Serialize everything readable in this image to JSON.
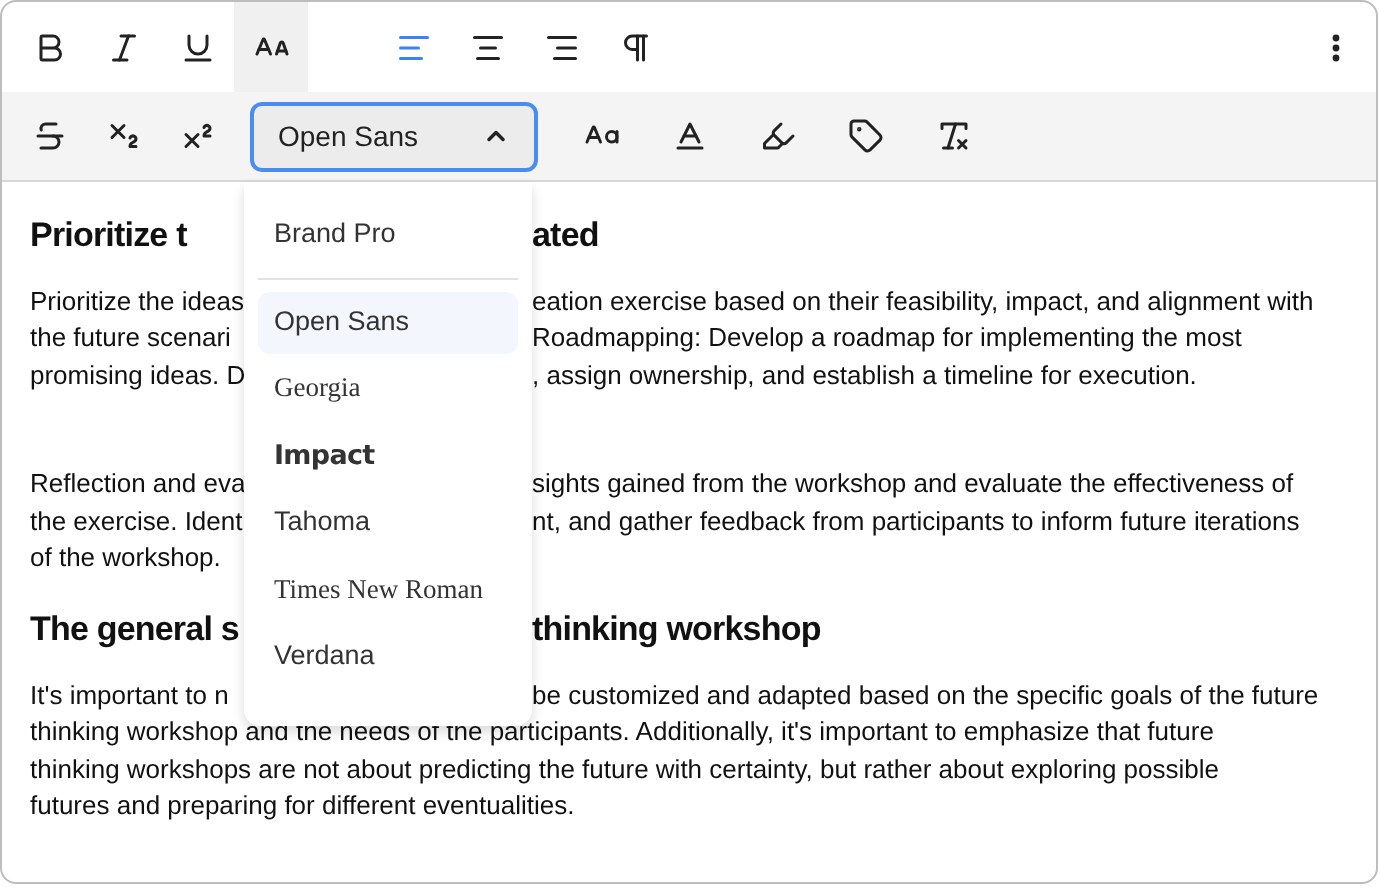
{
  "toolbar_row_1": [
    {
      "kind": "bold",
      "selected": false
    },
    {
      "kind": "italic",
      "selected": false
    },
    {
      "kind": "underline",
      "selected": false
    },
    {
      "kind": "text-style",
      "selected": true
    },
    {
      "kind": "align-left",
      "selected": true
    },
    {
      "kind": "align-center",
      "selected": false
    },
    {
      "kind": "align-right",
      "selected": false
    },
    {
      "kind": "paragraph",
      "selected": false
    }
  ],
  "toolbar_row_2": [
    {
      "kind": "strikethrough"
    },
    {
      "kind": "subscript"
    },
    {
      "kind": "superscript"
    }
  ],
  "font_select": {
    "value": "Open Sans",
    "expanded": true
  },
  "toolbar_row_2_after": [
    {
      "kind": "font-size"
    },
    {
      "kind": "font-color"
    },
    {
      "kind": "highlight"
    },
    {
      "kind": "tag"
    },
    {
      "kind": "clear-format"
    }
  ],
  "font_menu": [
    {
      "label": "Brand Pro",
      "kind": "sans",
      "selected": false,
      "divider_after": true
    },
    {
      "label": "Open Sans",
      "kind": "sans",
      "selected": true,
      "divider_after": false
    },
    {
      "label": "Georgia",
      "kind": "serif",
      "selected": false,
      "divider_after": false
    },
    {
      "label": "Impact",
      "kind": "display",
      "selected": false,
      "divider_after": false
    },
    {
      "label": "Tahoma",
      "kind": "sans",
      "selected": false,
      "divider_after": false
    },
    {
      "label": "Times New Roman",
      "kind": "serif",
      "selected": false,
      "divider_after": false
    },
    {
      "label": "Verdana",
      "kind": "sans",
      "selected": false,
      "divider_after": false
    }
  ],
  "document": [
    {
      "kind": "heading",
      "lines": [
        {
          "left": "Prioritize t",
          "right": "ated"
        }
      ]
    },
    {
      "kind": "paragraph",
      "lines": [
        {
          "left": "Prioritize the ideas",
          "right": "eation exercise based on their feasibility, impact, and alignment with"
        },
        {
          "left": "the future scenari",
          "right": "Roadmapping: Develop a roadmap for implementing the most"
        },
        {
          "left": "promising ideas. D",
          "right": ", assign ownership, and establish a timeline for execution."
        }
      ]
    },
    {
      "kind": "paragraph-spaced",
      "lines": [
        {
          "left": "Reflection and eva",
          "right": "sights gained from the workshop and evaluate the effectiveness of"
        },
        {
          "left": "the exercise. Ident",
          "right": "nt, and gather feedback from participants to inform future iterations"
        },
        {
          "left": "of the workshop."
        }
      ]
    },
    {
      "kind": "heading",
      "lines": [
        {
          "left": "The general s",
          "right": "thinking workshop"
        }
      ]
    },
    {
      "kind": "paragraph",
      "lines": [
        {
          "left": "It's important to n",
          "right": "be customized and adapted based on the specific goals of the future"
        },
        {
          "left": "thinking workshop and the needs of the participants. Additionally, it's important to emphasize that future"
        },
        {
          "left": "thinking workshops are not about predicting the future with certainty, but rather about exploring possible"
        },
        {
          "left": "futures and preparing for different eventualities."
        }
      ]
    }
  ]
}
